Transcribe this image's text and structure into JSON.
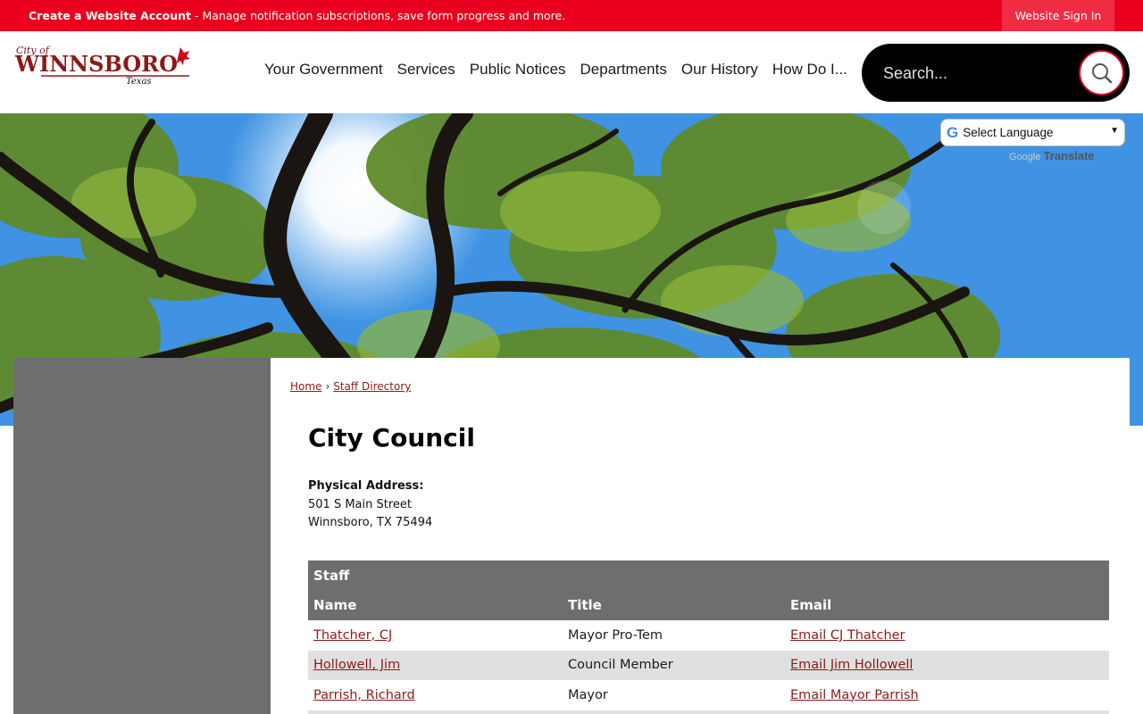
{
  "topbar": {
    "account_link": "Create a Website Account",
    "account_desc": " - Manage notification subscriptions, save form progress and more.",
    "signin_label": "Website Sign In",
    "bg_color": "#e8001e"
  },
  "logo": {
    "top": "City of",
    "main": "WINNSBORO",
    "sub": "Texas"
  },
  "nav": {
    "items": [
      {
        "label": "Your Government"
      },
      {
        "label": "Services"
      },
      {
        "label": "Public Notices"
      },
      {
        "label": "Departments"
      },
      {
        "label": "Our History"
      },
      {
        "label": "How Do I..."
      }
    ]
  },
  "search": {
    "placeholder": "Search...",
    "icon": "search-icon"
  },
  "translate": {
    "select_label": "Select Language",
    "powered": "Translate",
    "google": "Google"
  },
  "breadcrumb": {
    "home": "Home",
    "separator": "›",
    "current": "Staff Directory"
  },
  "page": {
    "title": "City Council",
    "address_label": "Physical Address:",
    "address_line1": "501 S Main Street",
    "address_line2": "Winnsboro, TX 75494"
  },
  "staff": {
    "caption": "Staff",
    "columns": {
      "name": "Name",
      "title": "Title",
      "email": "Email"
    },
    "rows": [
      {
        "name": "Thatcher, CJ",
        "title": "Mayor Pro-Tem",
        "email": "Email CJ Thatcher"
      },
      {
        "name": "Hollowell, Jim",
        "title": "Council Member",
        "email": "Email Jim Hollowell"
      },
      {
        "name": "Parrish, Richard",
        "title": "Mayor",
        "email": "Email Mayor Parrish"
      }
    ]
  },
  "colors": {
    "accent_red": "#e8001e",
    "link_maroon": "#8b1a1a",
    "sidebar_gray": "#6e6e6e"
  }
}
